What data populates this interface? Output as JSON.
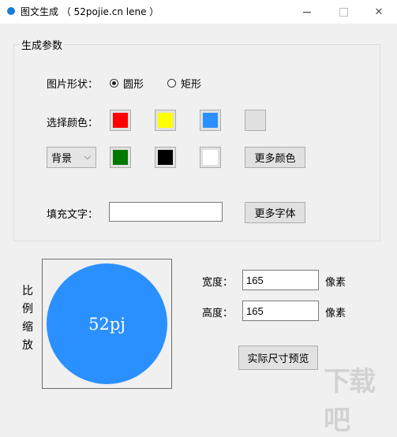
{
  "window": {
    "title": "图文生成 （ 52pojie.cn lene ）",
    "minimize_symbol": "—",
    "close_symbol": "✕"
  },
  "group": {
    "legend": "生成参数"
  },
  "shape": {
    "label": "图片形状：",
    "options": [
      {
        "label": "圆形",
        "checked": true
      },
      {
        "label": "矩形",
        "checked": false
      }
    ]
  },
  "colors": {
    "label": "选择颜色：",
    "row1": [
      "#ff0000",
      "#ffff00",
      "#2b90ff",
      "#e1e1e1"
    ],
    "target_select": "背景",
    "row2": [
      "#007800",
      "#000000",
      "#ffffff"
    ],
    "more_button": "更多颜色"
  },
  "fill_text": {
    "label": "填充文字：",
    "value": "",
    "more_fonts_button": "更多字体"
  },
  "preview": {
    "side_label": "比例缩放",
    "circle_color": "#2b90ff",
    "circle_text": "52pj"
  },
  "size": {
    "width_label": "宽度：",
    "width_value": "165",
    "height_label": "高度：",
    "height_value": "165",
    "unit": "像素",
    "preview_button": "实际尺寸预览"
  },
  "watermark": "下载吧"
}
